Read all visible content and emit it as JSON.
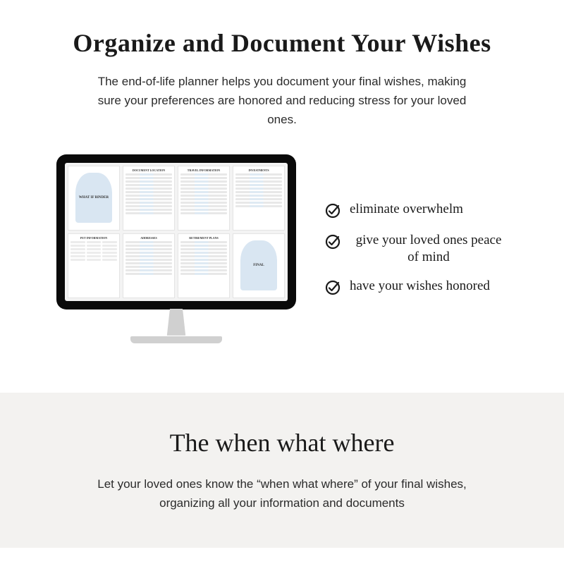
{
  "top": {
    "heading": "Organize and Document Your Wishes",
    "subtext": "The end-of-life planner helps you document your final wishes, making sure your preferences are honored and reducing stress for your loved ones."
  },
  "monitor": {
    "pages": [
      {
        "type": "arch",
        "label": "WHAT IF BINDER"
      },
      {
        "type": "table",
        "title": "DOCUMENT LOCATION"
      },
      {
        "type": "table",
        "title": "TRAVEL INFORMATION"
      },
      {
        "type": "lines",
        "title": "INVESTMENTS"
      },
      {
        "type": "grid",
        "title": "PET INFORMATION"
      },
      {
        "type": "lines",
        "title": "ADDRESSES"
      },
      {
        "type": "lines",
        "title": "RETIREMENT PLANS"
      },
      {
        "type": "arch",
        "label": "FINAL"
      }
    ]
  },
  "benefits": [
    "eliminate overwhelm",
    "give your loved ones peace of mind",
    "have your wishes honored"
  ],
  "bottom": {
    "heading": "The when what where",
    "subtext": "Let your loved ones know the “when what where” of your final wishes, organizing all your information and documents"
  }
}
